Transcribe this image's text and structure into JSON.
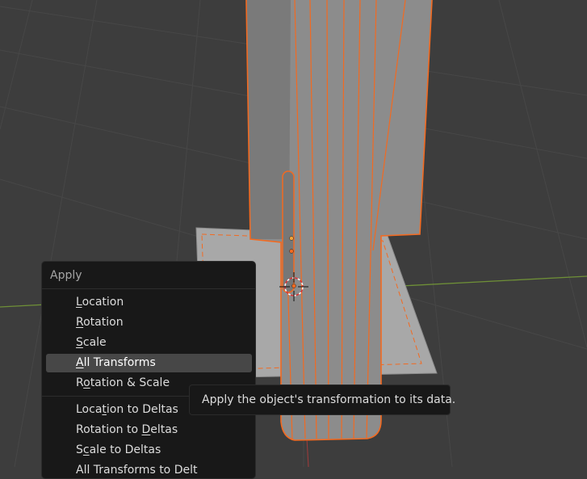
{
  "colors": {
    "background": "#3d3d3d",
    "grid": "#4a4a4a",
    "x_axis": "#7a9a3c",
    "selection_outline": "#f26a21",
    "menu_bg": "#181818",
    "menu_highlight": "#474747"
  },
  "menu": {
    "title": "Apply",
    "groups": [
      [
        {
          "pre": "",
          "ul": "L",
          "post": "ocation",
          "active": false
        },
        {
          "pre": "",
          "ul": "R",
          "post": "otation",
          "active": false
        },
        {
          "pre": "",
          "ul": "S",
          "post": "cale",
          "active": false
        },
        {
          "pre": "",
          "ul": "A",
          "post": "ll Transforms",
          "active": true
        },
        {
          "pre": "R",
          "ul": "o",
          "post": "tation & Scale",
          "active": false
        }
      ],
      [
        {
          "pre": "Loca",
          "ul": "t",
          "post": "ion to Deltas",
          "active": false
        },
        {
          "pre": "Rotation to ",
          "ul": "D",
          "post": "eltas",
          "active": false
        },
        {
          "pre": "S",
          "ul": "c",
          "post": "ale to Deltas",
          "active": false
        },
        {
          "pre": "All Transforms to Delt",
          "ul": "",
          "post": "",
          "active": false
        }
      ]
    ]
  },
  "tooltip": {
    "text": "Apply the object's transformation to its data."
  }
}
